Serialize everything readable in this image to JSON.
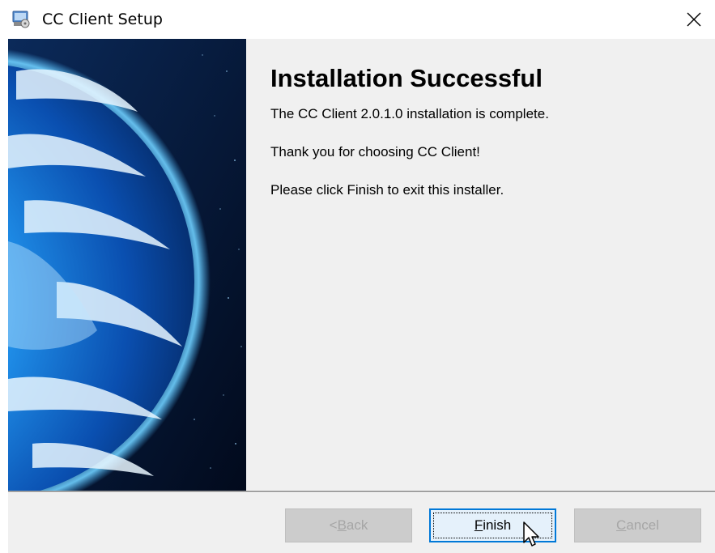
{
  "window": {
    "title": "CC Client Setup"
  },
  "icons": {
    "app": "installer-app-icon",
    "close": "close-icon",
    "cursor": "mouse-pointer-icon"
  },
  "main": {
    "heading": "Installation Successful",
    "messages": [
      "The CC Client 2.0.1.0 installation is complete.",
      "Thank you for choosing CC Client!",
      "Please click Finish to exit this installer."
    ]
  },
  "buttons": {
    "back": {
      "prefix": "< ",
      "mnemonic": "B",
      "rest": "ack",
      "enabled": false
    },
    "finish": {
      "prefix": "",
      "mnemonic": "F",
      "rest": "inish",
      "enabled": true
    },
    "cancel": {
      "prefix": "",
      "mnemonic": "C",
      "rest": "ancel",
      "enabled": false
    }
  },
  "colors": {
    "accent": "#0078d7",
    "dialog_bg": "#f0f0f0",
    "disabled_text": "#a6a6a6"
  }
}
